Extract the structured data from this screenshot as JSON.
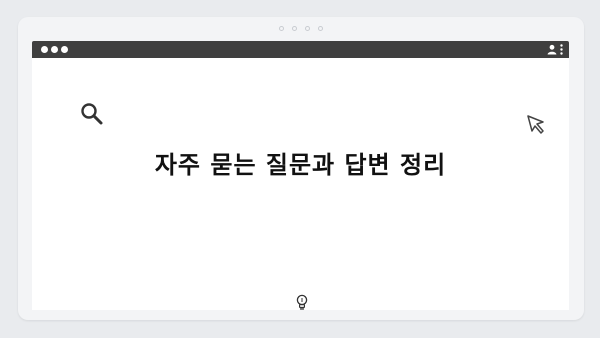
{
  "page": {
    "title": "자주 묻는 질문과 답변 정리"
  },
  "icons": {
    "search": "search-icon",
    "cursor": "cursor-arrow-icon",
    "bulb": "lightbulb-icon",
    "account": "account-icon",
    "menu": "kebab-menu-icon"
  },
  "colors": {
    "toolbar": "#3f3f3f",
    "background": "#e9ebee",
    "frame": "#f3f4f6",
    "content": "#ffffff",
    "text": "#111111"
  }
}
